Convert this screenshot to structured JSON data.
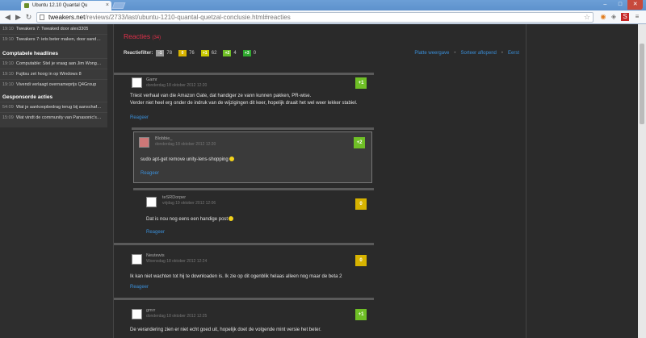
{
  "browser": {
    "tab_title": "Ubuntu 12.10 Quantal Qu",
    "url_host": "tweakers.net",
    "url_path": "/reviews/2733/last/ubuntu-1210-quantal-quetzal-conclusie.html#reacties",
    "controls": {
      "minimize": "–",
      "maximize": "□",
      "close": "✕"
    }
  },
  "sidebar": {
    "top_rows": [
      {
        "date": "19:10",
        "text": "Tweakers 7: Tweaked door alex3305"
      },
      {
        "date": "19:10",
        "text": "Tweakers 7: iets beter maken, door sand…"
      }
    ],
    "sections": [
      {
        "title": "Comptabele headlines",
        "rows": [
          {
            "date": "19:10",
            "text": "Computable: Stel je vraag aan Jim Wong…"
          },
          {
            "date": "19:10",
            "text": "Fujitsu zet hoog in op Windows 8"
          },
          {
            "date": "19:10",
            "text": "Vivendi verlaagt overnameprijs Q4Group"
          }
        ]
      },
      {
        "title": "Gesponsorde acties",
        "rows": [
          {
            "date": "54:09",
            "text": "Wat je aankoopbedrag terug bij aanschaf…"
          },
          {
            "date": "15:09",
            "text": "Wat vindt de community van Panasonic's…"
          }
        ]
      }
    ]
  },
  "reactions": {
    "heading": "Reacties",
    "count": "(34)",
    "filter_label": "Reactiefilter:",
    "filters": [
      {
        "chip": "-1",
        "count": "78",
        "color": "#999999"
      },
      {
        "chip": "0",
        "count": "76",
        "color": "#d7b300"
      },
      {
        "chip": "+1",
        "count": "62",
        "color": "#c7c700"
      },
      {
        "chip": "+2",
        "count": "4",
        "color": "#6fbf26"
      },
      {
        "chip": "+3",
        "count": "0",
        "color": "#2fa82f"
      }
    ],
    "links": [
      "Platte weergave",
      "Sorteer aflopend",
      "Eerst"
    ],
    "reply_label": "Reageer"
  },
  "comments": [
    {
      "author": "Gamr",
      "meta": "donderdag 18 oktober 2012 12:20",
      "score": "+1",
      "lines": [
        "Triest verhaal van die Amazon Gate, dat handiger ze vann kunnen pakken, PR-wise.",
        "Verder niet heel erg onder de indruk van de wijzigingen dit keer, hopelijk draait het wel weer lekker stabiel."
      ]
    },
    {
      "author": "Blobbie_",
      "meta": "donderdag 18 oktober 2012 12:20",
      "score": "+2",
      "lines": [
        "sudo apt-get remove unity-lens-shopping"
      ]
    },
    {
      "author": "teSRDorper",
      "meta": "vrijdag 19 oktober 2012 12:06",
      "score": "0",
      "lines": [
        "Dat is nou nog eens een handige post"
      ]
    },
    {
      "author": "Neutewis",
      "meta": "Woensdag 18 oktober 2012 12:24",
      "score": "0",
      "lines": [
        "Ik kan niet wachten tot hij te downloaden is. Ik zie op dit ogenblik helaas alleen nog maar de beta 2"
      ]
    },
    {
      "author": "gmrr",
      "meta": "donderdag 18 oktober 2012 12:25",
      "score": "+1",
      "lines": [
        "De verandering zien er niet echt goed uit, hopelijk doet de volgende mint versie het beter."
      ]
    }
  ]
}
